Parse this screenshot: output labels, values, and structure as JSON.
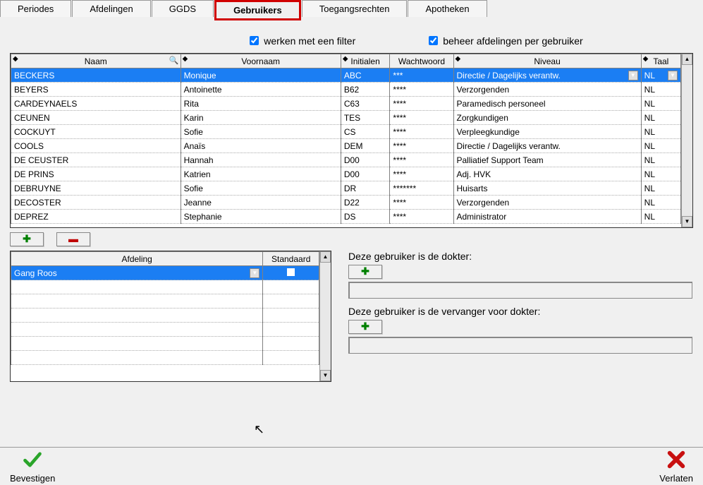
{
  "tabs": {
    "periodes": "Periodes",
    "afdelingen": "Afdelingen",
    "ggds": "GGDS",
    "gebruikers": "Gebruikers",
    "toegangsrechten": "Toegangsrechten",
    "apotheken": "Apotheken"
  },
  "filters": {
    "filter_label": "werken met een filter",
    "beheer_label": "beheer afdelingen per gebruiker"
  },
  "users_columns": {
    "naam": "Naam",
    "voornaam": "Voornaam",
    "initialen": "Initialen",
    "wachtwoord": "Wachtwoord",
    "niveau": "Niveau",
    "taal": "Taal"
  },
  "users": [
    {
      "naam": "BECKERS",
      "voornaam": "Monique",
      "initialen": "ABC",
      "wachtwoord": "***",
      "niveau": "Directie / Dagelijks verantw.",
      "taal": "NL",
      "selected": true
    },
    {
      "naam": "BEYERS",
      "voornaam": "Antoinette",
      "initialen": "B62",
      "wachtwoord": "****",
      "niveau": "Verzorgenden",
      "taal": "NL"
    },
    {
      "naam": "CARDEYNAELS",
      "voornaam": "Rita",
      "initialen": "C63",
      "wachtwoord": "****",
      "niveau": "Paramedisch personeel",
      "taal": "NL"
    },
    {
      "naam": "CEUNEN",
      "voornaam": "Karin",
      "initialen": "TES",
      "wachtwoord": "****",
      "niveau": "Zorgkundigen",
      "taal": "NL"
    },
    {
      "naam": "COCKUYT",
      "voornaam": "Sofie",
      "initialen": "CS",
      "wachtwoord": "****",
      "niveau": "Verpleegkundige",
      "taal": "NL"
    },
    {
      "naam": "COOLS",
      "voornaam": "Anaïs",
      "initialen": "DEM",
      "wachtwoord": "****",
      "niveau": "Directie / Dagelijks verantw.",
      "taal": "NL"
    },
    {
      "naam": "DE CEUSTER",
      "voornaam": "Hannah",
      "initialen": "D00",
      "wachtwoord": "****",
      "niveau": "Palliatief Support Team",
      "taal": "NL"
    },
    {
      "naam": "DE PRINS",
      "voornaam": "Katrien",
      "initialen": "D00",
      "wachtwoord": "****",
      "niveau": "Adj. HVK",
      "taal": "NL"
    },
    {
      "naam": "DEBRUYNE",
      "voornaam": "Sofie",
      "initialen": "DR",
      "wachtwoord": "*******",
      "niveau": "Huisarts",
      "taal": "NL"
    },
    {
      "naam": "DECOSTER",
      "voornaam": "Jeanne",
      "initialen": "D22",
      "wachtwoord": "****",
      "niveau": "Verzorgenden",
      "taal": "NL"
    },
    {
      "naam": "DEPREZ",
      "voornaam": "Stephanie",
      "initialen": "DS",
      "wachtwoord": "****",
      "niveau": "Administrator",
      "taal": "NL"
    }
  ],
  "afdeling_columns": {
    "afdeling": "Afdeling",
    "standaard": "Standaard"
  },
  "afdelingen": [
    {
      "afdeling": "Gang Roos",
      "standaard": false,
      "selected": true
    }
  ],
  "right": {
    "doctor_label": "Deze gebruiker is de dokter:",
    "sub_label": "Deze gebruiker is de vervanger voor dokter:"
  },
  "bottom": {
    "confirm": "Bevestigen",
    "leave": "Verlaten"
  }
}
